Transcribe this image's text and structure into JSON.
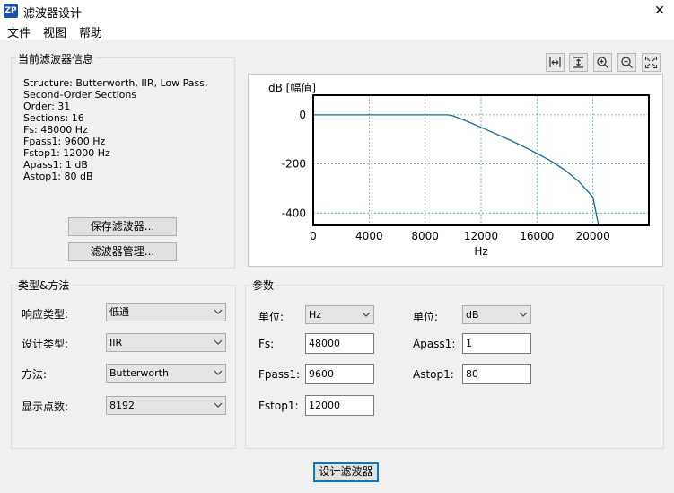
{
  "window": {
    "icon_text": "ZP",
    "title": "滤波器设计",
    "close_symbol": "✕"
  },
  "menu": [
    "文件",
    "视图",
    "帮助"
  ],
  "info_panel": {
    "title": "当前滤波器信息",
    "lines": [
      "Structure: Butterworth, IIR, Low Pass,",
      "Second-Order Sections",
      "Order: 31",
      "Sections: 16",
      "Fs: 48000 Hz",
      "Fpass1: 9600 Hz",
      "Fstop1: 12000 Hz",
      "Apass1: 1 dB",
      "Astop1: 80 dB"
    ],
    "save_button": "保存滤波器...",
    "manage_button": "滤波器管理..."
  },
  "toolbar": {
    "icons": [
      "horizontal-fit-icon",
      "vertical-fit-icon",
      "zoom-in-icon",
      "zoom-out-icon",
      "fit-all-icon"
    ]
  },
  "chart_data": {
    "type": "line",
    "ylabel": "dB [幅值]",
    "xlabel": "Hz",
    "xlim": [
      0,
      24000
    ],
    "ylim": [
      -450,
      80
    ],
    "xticks": [
      0,
      4000,
      8000,
      12000,
      16000,
      20000
    ],
    "yticks": [
      0,
      -200,
      -400
    ],
    "grid": true,
    "colors": {
      "line": "#0e6d92",
      "grid": "#5aa0a8"
    },
    "series": [
      {
        "x": [
          0,
          4000,
          8000,
          9600,
          10000,
          11000,
          12000,
          13000,
          14000,
          15000,
          16000,
          17000,
          18000,
          19000,
          20000,
          20400
        ],
        "y": [
          0,
          0,
          0,
          0,
          -4,
          -26,
          -51,
          -76,
          -101,
          -128,
          -157,
          -188,
          -225,
          -272,
          -335,
          -455
        ]
      }
    ]
  },
  "type_panel": {
    "title": "类型&方法",
    "response_label": "响应类型:",
    "response_value": "低通",
    "design_label": "设计类型:",
    "design_value": "IIR",
    "method_label": "方法:",
    "method_value": "Butterworth",
    "points_label": "显示点数:",
    "points_value": "8192"
  },
  "params_panel": {
    "title": "参数",
    "freq_unit_label": "单位:",
    "freq_unit_value": "Hz",
    "fs_label": "Fs:",
    "fs_value": "48000",
    "fpass_label": "Fpass1:",
    "fpass_value": "9600",
    "fstop_label": "Fstop1:",
    "fstop_value": "12000",
    "mag_unit_label": "单位:",
    "mag_unit_value": "dB",
    "apass_label": "Apass1:",
    "apass_value": "1",
    "astop_label": "Astop1:",
    "astop_value": "80"
  },
  "design_button": "设计滤波器"
}
